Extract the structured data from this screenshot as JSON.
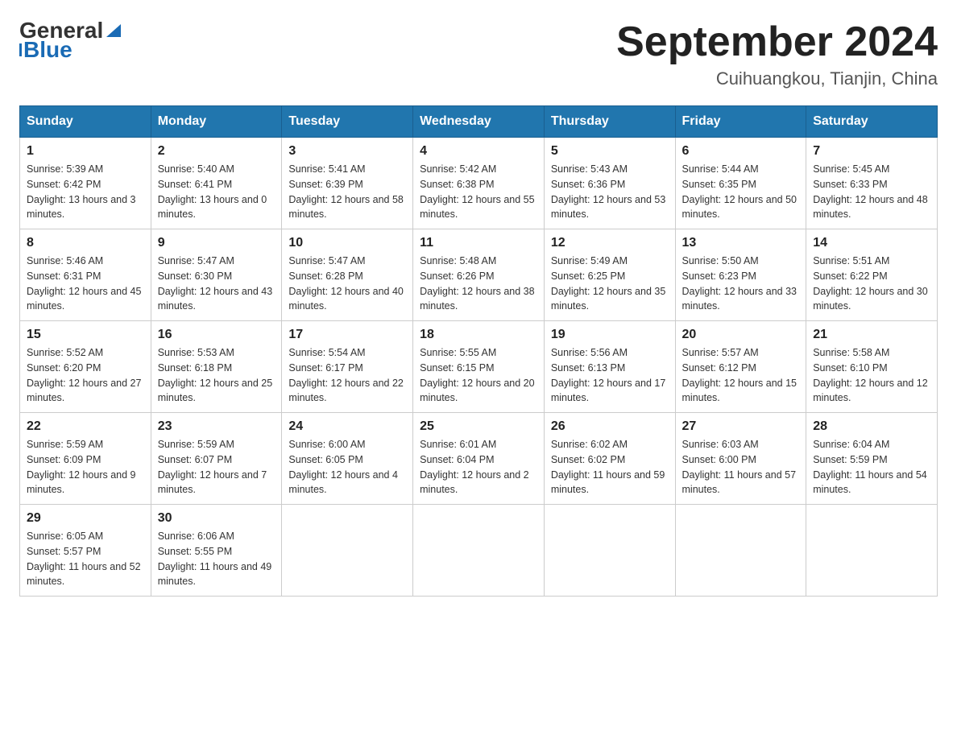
{
  "header": {
    "logo_text_black": "General",
    "logo_text_blue": "Blue",
    "month_title": "September 2024",
    "subtitle": "Cuihuangkou, Tianjin, China"
  },
  "days_of_week": [
    "Sunday",
    "Monday",
    "Tuesday",
    "Wednesday",
    "Thursday",
    "Friday",
    "Saturday"
  ],
  "weeks": [
    [
      {
        "day": "1",
        "sunrise": "5:39 AM",
        "sunset": "6:42 PM",
        "daylight": "13 hours and 3 minutes."
      },
      {
        "day": "2",
        "sunrise": "5:40 AM",
        "sunset": "6:41 PM",
        "daylight": "13 hours and 0 minutes."
      },
      {
        "day": "3",
        "sunrise": "5:41 AM",
        "sunset": "6:39 PM",
        "daylight": "12 hours and 58 minutes."
      },
      {
        "day": "4",
        "sunrise": "5:42 AM",
        "sunset": "6:38 PM",
        "daylight": "12 hours and 55 minutes."
      },
      {
        "day": "5",
        "sunrise": "5:43 AM",
        "sunset": "6:36 PM",
        "daylight": "12 hours and 53 minutes."
      },
      {
        "day": "6",
        "sunrise": "5:44 AM",
        "sunset": "6:35 PM",
        "daylight": "12 hours and 50 minutes."
      },
      {
        "day": "7",
        "sunrise": "5:45 AM",
        "sunset": "6:33 PM",
        "daylight": "12 hours and 48 minutes."
      }
    ],
    [
      {
        "day": "8",
        "sunrise": "5:46 AM",
        "sunset": "6:31 PM",
        "daylight": "12 hours and 45 minutes."
      },
      {
        "day": "9",
        "sunrise": "5:47 AM",
        "sunset": "6:30 PM",
        "daylight": "12 hours and 43 minutes."
      },
      {
        "day": "10",
        "sunrise": "5:47 AM",
        "sunset": "6:28 PM",
        "daylight": "12 hours and 40 minutes."
      },
      {
        "day": "11",
        "sunrise": "5:48 AM",
        "sunset": "6:26 PM",
        "daylight": "12 hours and 38 minutes."
      },
      {
        "day": "12",
        "sunrise": "5:49 AM",
        "sunset": "6:25 PM",
        "daylight": "12 hours and 35 minutes."
      },
      {
        "day": "13",
        "sunrise": "5:50 AM",
        "sunset": "6:23 PM",
        "daylight": "12 hours and 33 minutes."
      },
      {
        "day": "14",
        "sunrise": "5:51 AM",
        "sunset": "6:22 PM",
        "daylight": "12 hours and 30 minutes."
      }
    ],
    [
      {
        "day": "15",
        "sunrise": "5:52 AM",
        "sunset": "6:20 PM",
        "daylight": "12 hours and 27 minutes."
      },
      {
        "day": "16",
        "sunrise": "5:53 AM",
        "sunset": "6:18 PM",
        "daylight": "12 hours and 25 minutes."
      },
      {
        "day": "17",
        "sunrise": "5:54 AM",
        "sunset": "6:17 PM",
        "daylight": "12 hours and 22 minutes."
      },
      {
        "day": "18",
        "sunrise": "5:55 AM",
        "sunset": "6:15 PM",
        "daylight": "12 hours and 20 minutes."
      },
      {
        "day": "19",
        "sunrise": "5:56 AM",
        "sunset": "6:13 PM",
        "daylight": "12 hours and 17 minutes."
      },
      {
        "day": "20",
        "sunrise": "5:57 AM",
        "sunset": "6:12 PM",
        "daylight": "12 hours and 15 minutes."
      },
      {
        "day": "21",
        "sunrise": "5:58 AM",
        "sunset": "6:10 PM",
        "daylight": "12 hours and 12 minutes."
      }
    ],
    [
      {
        "day": "22",
        "sunrise": "5:59 AM",
        "sunset": "6:09 PM",
        "daylight": "12 hours and 9 minutes."
      },
      {
        "day": "23",
        "sunrise": "5:59 AM",
        "sunset": "6:07 PM",
        "daylight": "12 hours and 7 minutes."
      },
      {
        "day": "24",
        "sunrise": "6:00 AM",
        "sunset": "6:05 PM",
        "daylight": "12 hours and 4 minutes."
      },
      {
        "day": "25",
        "sunrise": "6:01 AM",
        "sunset": "6:04 PM",
        "daylight": "12 hours and 2 minutes."
      },
      {
        "day": "26",
        "sunrise": "6:02 AM",
        "sunset": "6:02 PM",
        "daylight": "11 hours and 59 minutes."
      },
      {
        "day": "27",
        "sunrise": "6:03 AM",
        "sunset": "6:00 PM",
        "daylight": "11 hours and 57 minutes."
      },
      {
        "day": "28",
        "sunrise": "6:04 AM",
        "sunset": "5:59 PM",
        "daylight": "11 hours and 54 minutes."
      }
    ],
    [
      {
        "day": "29",
        "sunrise": "6:05 AM",
        "sunset": "5:57 PM",
        "daylight": "11 hours and 52 minutes."
      },
      {
        "day": "30",
        "sunrise": "6:06 AM",
        "sunset": "5:55 PM",
        "daylight": "11 hours and 49 minutes."
      },
      null,
      null,
      null,
      null,
      null
    ]
  ]
}
